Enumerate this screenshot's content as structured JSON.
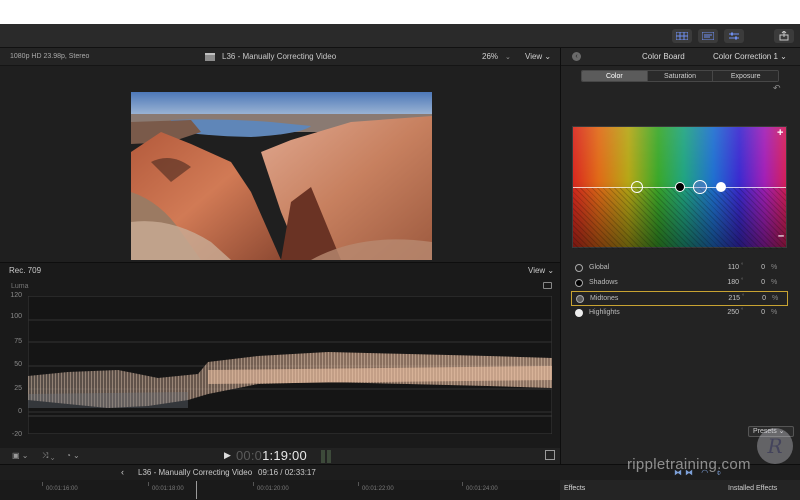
{
  "viewer": {
    "format": "1080p HD 23.98p, Stereo",
    "title": "L36 - Manually Correcting Video",
    "zoom": "26%",
    "view_label": "View"
  },
  "scope": {
    "standard": "Rec. 709",
    "view_label": "View",
    "mode": "Luma",
    "y_ticks": [
      "120",
      "100",
      "75",
      "50",
      "25",
      "0",
      "-20"
    ]
  },
  "playback": {
    "timecode_dim": "00:0",
    "timecode_lit": "1:19:00"
  },
  "inspector": {
    "title": "Color Board",
    "correction": "Color Correction 1",
    "tabs": [
      "Color",
      "Saturation",
      "Exposure"
    ],
    "active_tab": 0,
    "controls": [
      {
        "label": "Global",
        "angle": "110",
        "percent": "0",
        "percent_unit": "%",
        "selected": false
      },
      {
        "label": "Shadows",
        "angle": "180",
        "percent": "0",
        "percent_unit": "%",
        "selected": false
      },
      {
        "label": "Midtones",
        "angle": "215",
        "percent": "0",
        "percent_unit": "%",
        "selected": true
      },
      {
        "label": "Highlights",
        "angle": "250",
        "percent": "0",
        "percent_unit": "%",
        "selected": false
      }
    ],
    "presets_label": "Presets",
    "accent_color": "#c8a332"
  },
  "timeline": {
    "title": "L36 - Manually Correcting Video",
    "position": "09:16 / 02:33:17",
    "ruler": [
      "00:01:16:00",
      "00:01:18:00",
      "00:01:20:00",
      "00:01:22:00",
      "00:01:24:00"
    ]
  },
  "effects": {
    "label": "Effects",
    "installed": "Installed Effects"
  },
  "watermark": "rippletraining.com"
}
